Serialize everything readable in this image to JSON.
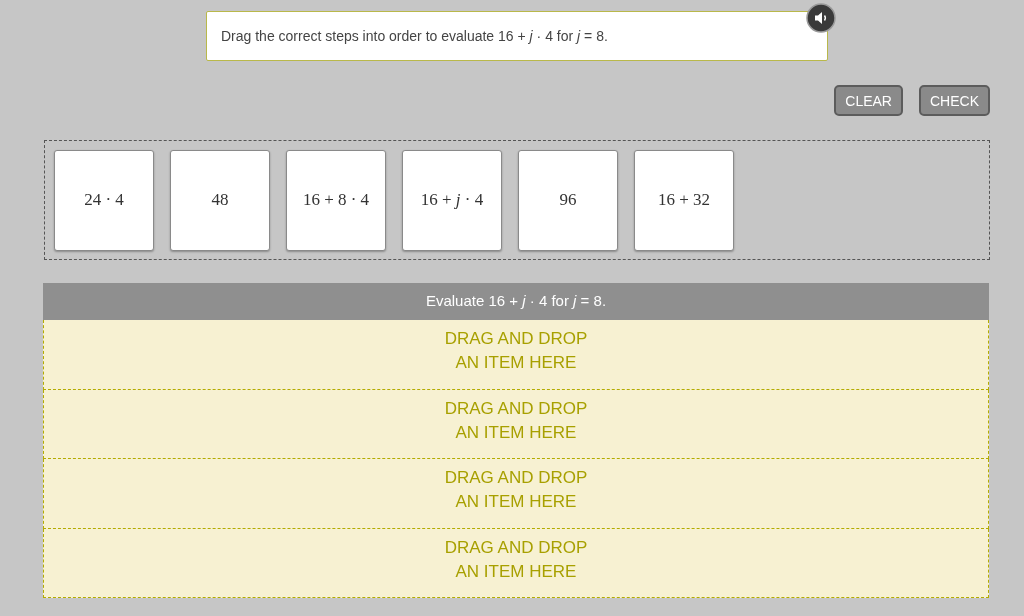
{
  "prompt": {
    "text": "Drag the correct steps into order to evaluate 16 + *j* · 4 for *j* = 8."
  },
  "buttons": [
    {
      "label": "CLEAR"
    },
    {
      "label": "CHECK"
    }
  ],
  "cards": [
    {
      "text": "24 · 4"
    },
    {
      "text": "48"
    },
    {
      "text": "16 + 8 · 4"
    },
    {
      "text": "16 + *j* · 4"
    },
    {
      "text": "96"
    },
    {
      "text": "16 + 32"
    }
  ],
  "answer_area": {
    "header": "Evaluate 16 + *j* · 4 for *j* = 8.",
    "slots": [
      {
        "text": "DRAG AND DROP\nAN ITEM HERE"
      },
      {
        "text": "DRAG AND DROP\nAN ITEM HERE"
      },
      {
        "text": "DRAG AND DROP\nAN ITEM HERE"
      },
      {
        "text": "DRAG AND DROP\nAN ITEM HERE"
      }
    ]
  }
}
